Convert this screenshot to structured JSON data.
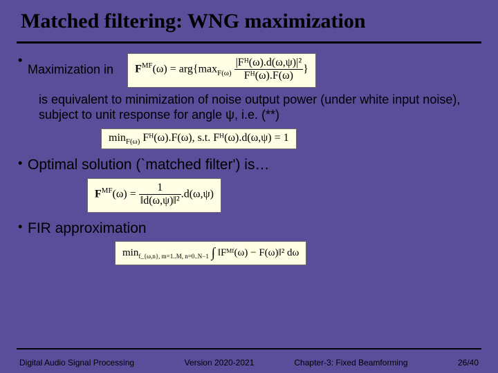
{
  "title": "Matched filtering: WNG maximization",
  "bullets": {
    "b1": "Maximization in",
    "b1_sub": "is equivalent to minimization of noise output power (under white input noise), subject to unit response for angle ψ, i.e.  (**)",
    "b2": "Optimal solution (`matched filter') is…",
    "b3": "FIR approximation"
  },
  "formulas": {
    "f1_left": "F",
    "f1_sup": "MF",
    "f1_omega": "(ω) = arg{max",
    "f1_subF": "F(ω)",
    "f1_frac_num": "|Fᴴ(ω).d(ω,ψ)|²",
    "f1_frac_den": "Fᴴ(ω).F(ω)",
    "f1_close": "}",
    "f2_min": "min",
    "f2_sub": "F(ω)",
    "f2_body": " Fᴴ(ω).F(ω),   s.t.  Fᴴ(ω).d(ω,ψ) = 1",
    "f3_left": "F",
    "f3_sup": "MF",
    "f3_mid": "(ω) = ",
    "f3_frac_num": "1",
    "f3_frac_den": "‖d(ω,ψ)‖²",
    "f3_right": ".d(ω,ψ)",
    "f4_min": "min",
    "f4_sub": "f_{ω,n}, m=1..M, n=0..N−1",
    "f4_int": "∫",
    "f4_body": "‖Fᴹᶠ(ω) − F(ω)‖² dω"
  },
  "footer": {
    "left": "Digital Audio Signal Processing",
    "version": "Version 2020-2021",
    "chapter": "Chapter-3: Fixed Beamforming",
    "page": "26/40"
  }
}
